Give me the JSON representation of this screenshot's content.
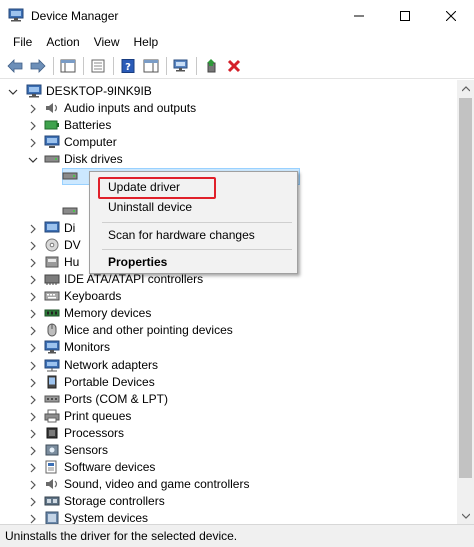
{
  "window": {
    "title": "Device Manager",
    "controls": {
      "minimize": "minimize",
      "maximize": "maximize",
      "close": "close"
    }
  },
  "menu": [
    "File",
    "Action",
    "View",
    "Help"
  ],
  "toolbar": {
    "icons": [
      "back-arrow-icon",
      "forward-arrow-icon",
      "show-hide-console-tree-icon",
      "properties-icon",
      "help-icon",
      "action-pane-icon",
      "scan-hardware-icon",
      "add-driver-icon",
      "uninstall-red-x-icon"
    ],
    "accent_red": "#d4202a",
    "accent_green": "#2f9a3a",
    "accent_blue": "#1f5fbf"
  },
  "tree": {
    "root": "DESKTOP-9INK9IB",
    "nodes": [
      {
        "label": "Audio inputs and outputs",
        "icon": "speaker-icon",
        "expanded": false
      },
      {
        "label": "Batteries",
        "icon": "battery-icon",
        "expanded": false
      },
      {
        "label": "Computer",
        "icon": "computer-icon",
        "expanded": false
      },
      {
        "label": "Disk drives",
        "icon": "disk-drive-icon",
        "expanded": true
      },
      {
        "label": "Di",
        "icon": "display-icon",
        "expanded": false
      },
      {
        "label": "DV",
        "icon": "dvd-icon",
        "expanded": false
      },
      {
        "label": "Hu",
        "icon": "hid-icon",
        "expanded": false
      },
      {
        "label": "IDE ATA/ATAPI controllers",
        "icon": "ide-controller-icon",
        "expanded": false
      },
      {
        "label": "Keyboards",
        "icon": "keyboard-icon",
        "expanded": false
      },
      {
        "label": "Memory devices",
        "icon": "memory-icon",
        "expanded": false
      },
      {
        "label": "Mice and other pointing devices",
        "icon": "mouse-icon",
        "expanded": false
      },
      {
        "label": "Monitors",
        "icon": "monitor-icon",
        "expanded": false
      },
      {
        "label": "Network adapters",
        "icon": "network-icon",
        "expanded": false
      },
      {
        "label": "Portable Devices",
        "icon": "portable-device-icon",
        "expanded": false
      },
      {
        "label": "Ports (COM & LPT)",
        "icon": "port-icon",
        "expanded": false
      },
      {
        "label": "Print queues",
        "icon": "printer-icon",
        "expanded": false
      },
      {
        "label": "Processors",
        "icon": "processor-icon",
        "expanded": false
      },
      {
        "label": "Sensors",
        "icon": "sensor-icon",
        "expanded": false
      },
      {
        "label": "Software devices",
        "icon": "software-device-icon",
        "expanded": false
      },
      {
        "label": "Sound, video and game controllers",
        "icon": "sound-icon",
        "expanded": false
      },
      {
        "label": "Storage controllers",
        "icon": "storage-controller-icon",
        "expanded": false
      },
      {
        "label": "System devices",
        "icon": "system-device-icon",
        "expanded": false
      }
    ]
  },
  "context_menu": {
    "items": [
      "Update driver",
      "Uninstall device",
      "Scan for hardware changes",
      "Properties"
    ],
    "highlight_color": "#e0202a"
  },
  "status": "Uninstalls the driver for the selected device."
}
